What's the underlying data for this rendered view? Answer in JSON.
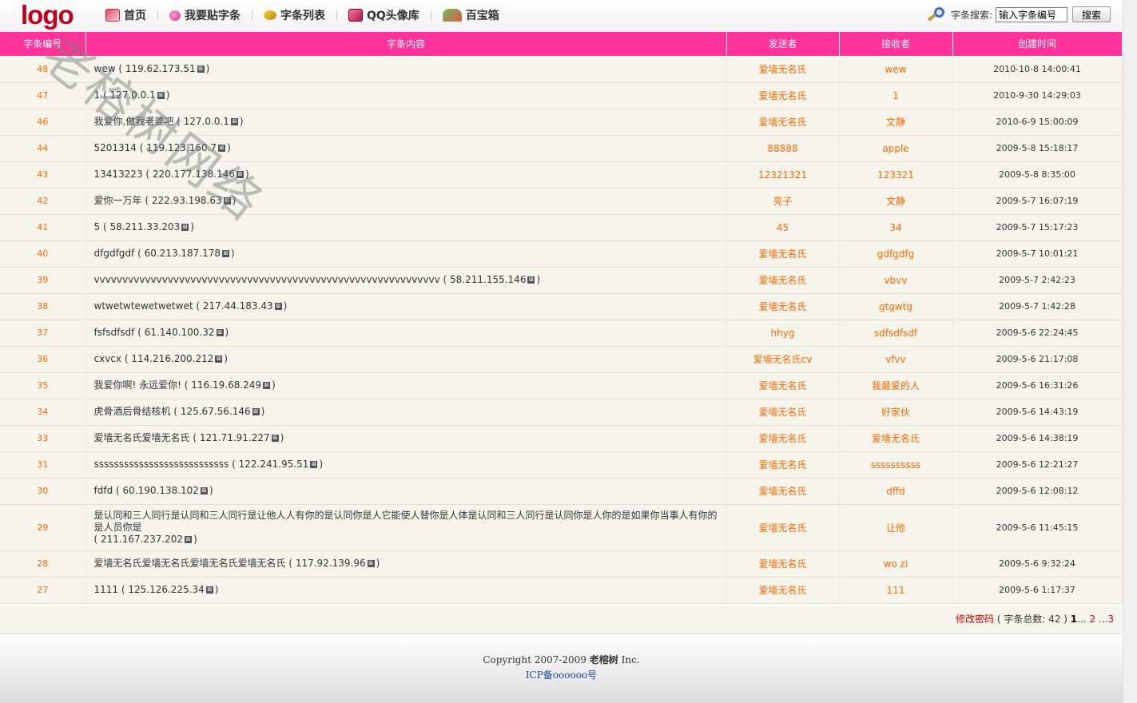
{
  "header": {
    "logo": "logo",
    "nav": [
      {
        "label": "首页",
        "icon": "home-icon"
      },
      {
        "label": "我要贴字条",
        "icon": "heart-icon"
      },
      {
        "label": "字条列表",
        "icon": "list-icon"
      },
      {
        "label": "QQ头像库",
        "icon": "qq-icon"
      },
      {
        "label": "百宝箱",
        "icon": "treasure-box-icon"
      }
    ],
    "search": {
      "label": "字条搜索:",
      "value": "输入字条编号",
      "button": "搜索"
    }
  },
  "watermark": "老榕树网络",
  "table": {
    "headers": [
      "字条编号",
      "字条内容",
      "发送者",
      "接收者",
      "创建时间"
    ],
    "delete_glyph": "⊠",
    "rows": [
      {
        "id": "48",
        "content": "wew",
        "ip": "( 119.62.173.51",
        "sender": "爱墙无名氏",
        "receiver": "wew",
        "time": "2010-10-8 14:00:41"
      },
      {
        "id": "47",
        "content": "1",
        "ip": "( 127.0.0.1",
        "sender": "爱墙无名氏",
        "receiver": "1",
        "time": "2010-9-30 14:29:03"
      },
      {
        "id": "46",
        "content": "我爱你,做我老婆吧",
        "ip": "( 127.0.0.1",
        "sender": "爱墙无名氏",
        "receiver": "文静",
        "time": "2010-6-9 15:00:09"
      },
      {
        "id": "44",
        "content": "5201314",
        "ip": "( 119.123.160.7",
        "sender": "88888",
        "receiver": "apple",
        "time": "2009-5-8 15:18:17"
      },
      {
        "id": "43",
        "content": "13413223",
        "ip": "( 220.177.138.146",
        "sender": "12321321",
        "receiver": "123321",
        "time": "2009-5-8 8:35:00"
      },
      {
        "id": "42",
        "content": "爱你一万年",
        "ip": "( 222.93.198.63",
        "sender": "亮子",
        "receiver": "文静",
        "time": "2009-5-7 16:07:19"
      },
      {
        "id": "41",
        "content": "5",
        "ip": "( 58.211.33.203",
        "sender": "45",
        "receiver": "34",
        "time": "2009-5-7 15:17:23"
      },
      {
        "id": "40",
        "content": "dfgdfgdf",
        "ip": "( 60.213.187.178",
        "sender": "爱墙无名氏",
        "receiver": "gdfgdfg",
        "time": "2009-5-7 10:01:21"
      },
      {
        "id": "39",
        "content": "vvvvvvvvvvvvvvvvvvvvvvvvvvvvvvvvvvvvvvvvvvvvvvvvvvvvvvvvvvvvv",
        "ip": "( 58.211.155.146",
        "sender": "爱墙无名氏",
        "receiver": "vbvv",
        "time": "2009-5-7 2:42:23"
      },
      {
        "id": "38",
        "content": "wtwetwtewetwetwet",
        "ip": "( 217.44.183.43",
        "sender": "爱墙无名氏",
        "receiver": "gtgwtg",
        "time": "2009-5-7 1:42:28"
      },
      {
        "id": "37",
        "content": "fsfsdfsdf",
        "ip": "( 61.140.100.32",
        "sender": "hhyg",
        "receiver": "sdfsdfsdf",
        "time": "2009-5-6 22:24:45"
      },
      {
        "id": "36",
        "content": "cxvcx",
        "ip": "( 114.216.200.212",
        "sender": "爱墙无名氏cv",
        "receiver": "vfvv",
        "time": "2009-5-6 21:17:08"
      },
      {
        "id": "35",
        "content": "我爱你啊! 永远爱你!",
        "ip": "( 116.19.68.249",
        "sender": "爱墙无名氏",
        "receiver": "我最爱的人",
        "time": "2009-5-6 16:31:26"
      },
      {
        "id": "34",
        "content": "虎骨酒后骨结核机",
        "ip": "( 125.67.56.146",
        "sender": "爱墙无名氏",
        "receiver": "好家伙",
        "time": "2009-5-6 14:43:19"
      },
      {
        "id": "33",
        "content": "爱墙无名氏爱墙无名氏",
        "ip": "( 121.71.91.227",
        "sender": "爱墙无名氏",
        "receiver": "爱墙无名氏",
        "time": "2009-5-6 14:38:19"
      },
      {
        "id": "31",
        "content": "sssssssssssssssssssssssssss",
        "ip": "( 122.241.95.51",
        "sender": "爱墙无名氏",
        "receiver": "ssssssssss",
        "time": "2009-5-6 12:21:27"
      },
      {
        "id": "30",
        "content": "fdfd",
        "ip": "( 60.190.138.102",
        "sender": "爱墙无名氏",
        "receiver": "dffd",
        "time": "2009-5-6 12:08:12"
      },
      {
        "id": "29",
        "content": "是认同和三人同行是认同和三人同行是让他人人有你的是认同你是人它能使人替你是人体是认同和三人同行是认同你是人你的是如果你当事人有你的是人员你是",
        "ip": "( 211.167.237.202",
        "sender": "爱墙无名氏",
        "receiver": "让他",
        "time": "2009-5-6 11:45:15",
        "tall": true
      },
      {
        "id": "28",
        "content": "爱墙无名氏爱墙无名氏爱墙无名氏爱墙无名氏",
        "ip": "( 117.92.139.96",
        "sender": "爱墙无名氏",
        "receiver": "wo zi",
        "time": "2009-5-6 9:32:24"
      },
      {
        "id": "27",
        "content": "1111",
        "ip": "( 125.126.225.34",
        "sender": "爱墙无名氏",
        "receiver": "111",
        "time": "2009-5-6 1:17:37"
      }
    ]
  },
  "pager": {
    "change_password": "修改密码",
    "total": "( 字条总数: 42 )",
    "current": "1",
    "ellipsis1": "...",
    "page2": "2",
    "ellipsis2": "...",
    "page3": "3"
  },
  "footer": {
    "copyright_prefix": "Copyright 2007-2009",
    "brand": "老榕树",
    "copyright_suffix": "Inc.",
    "icp": "ICP备oooooo号"
  },
  "colors": {
    "header_bg": "#ff3399",
    "row_bg": "#f5f5ec",
    "accent": "#ff6600",
    "logo": "#c0001a"
  }
}
